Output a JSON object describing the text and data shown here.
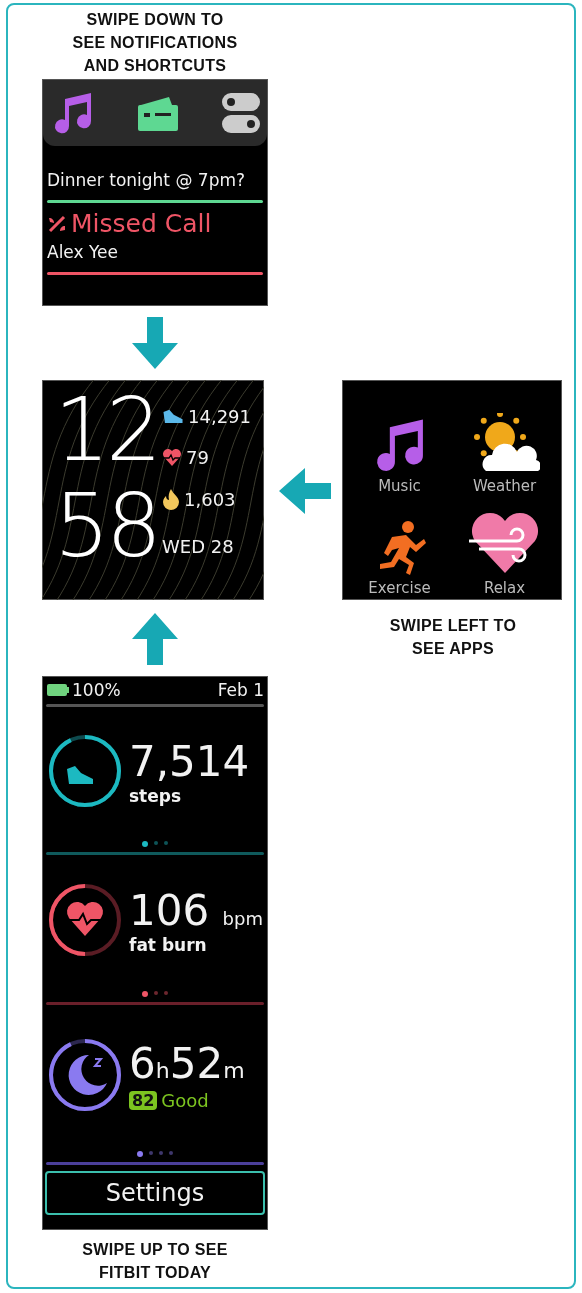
{
  "notifications_panel": {
    "caption": "SWIPE DOWN TO\nSEE NOTIFICATIONS\nAND SHORTCUTS",
    "message": "Dinner tonight @ 7pm?",
    "missed_call": {
      "title": "Missed Call",
      "name": "Alex Yee"
    }
  },
  "clock_face": {
    "hour": "12",
    "minute": "58",
    "steps": "14,291",
    "heart_rate": "79",
    "calories": "1,603",
    "date": "WED 28"
  },
  "apps_panel": {
    "caption": "SWIPE LEFT TO\nSEE APPS",
    "apps": [
      {
        "kind": "music",
        "label": "Music"
      },
      {
        "kind": "weather",
        "label": "Weather"
      },
      {
        "kind": "exercise",
        "label": "Exercise"
      },
      {
        "kind": "relax",
        "label": "Relax"
      }
    ]
  },
  "today_panel": {
    "caption": "SWIPE UP TO SEE\nFITBIT TODAY",
    "battery": "100%",
    "date": "Feb 1",
    "steps": {
      "value": "7,514",
      "label": "steps",
      "dots": [
        {
          "selected": true
        },
        {
          "selected": false
        },
        {
          "selected": false
        }
      ]
    },
    "heart": {
      "value": "106",
      "unit": "bpm",
      "label": "fat burn",
      "dots": [
        {
          "selected": true
        },
        {
          "selected": false
        },
        {
          "selected": false
        }
      ]
    },
    "sleep": {
      "hours": "6",
      "hours_unit": "h",
      "minutes": "52",
      "minutes_unit": "m",
      "score": "82",
      "rating": "Good",
      "dots": [
        {
          "selected": true
        },
        {
          "selected": false
        },
        {
          "selected": false
        },
        {
          "selected": false
        }
      ]
    },
    "settings_button": "Settings"
  }
}
